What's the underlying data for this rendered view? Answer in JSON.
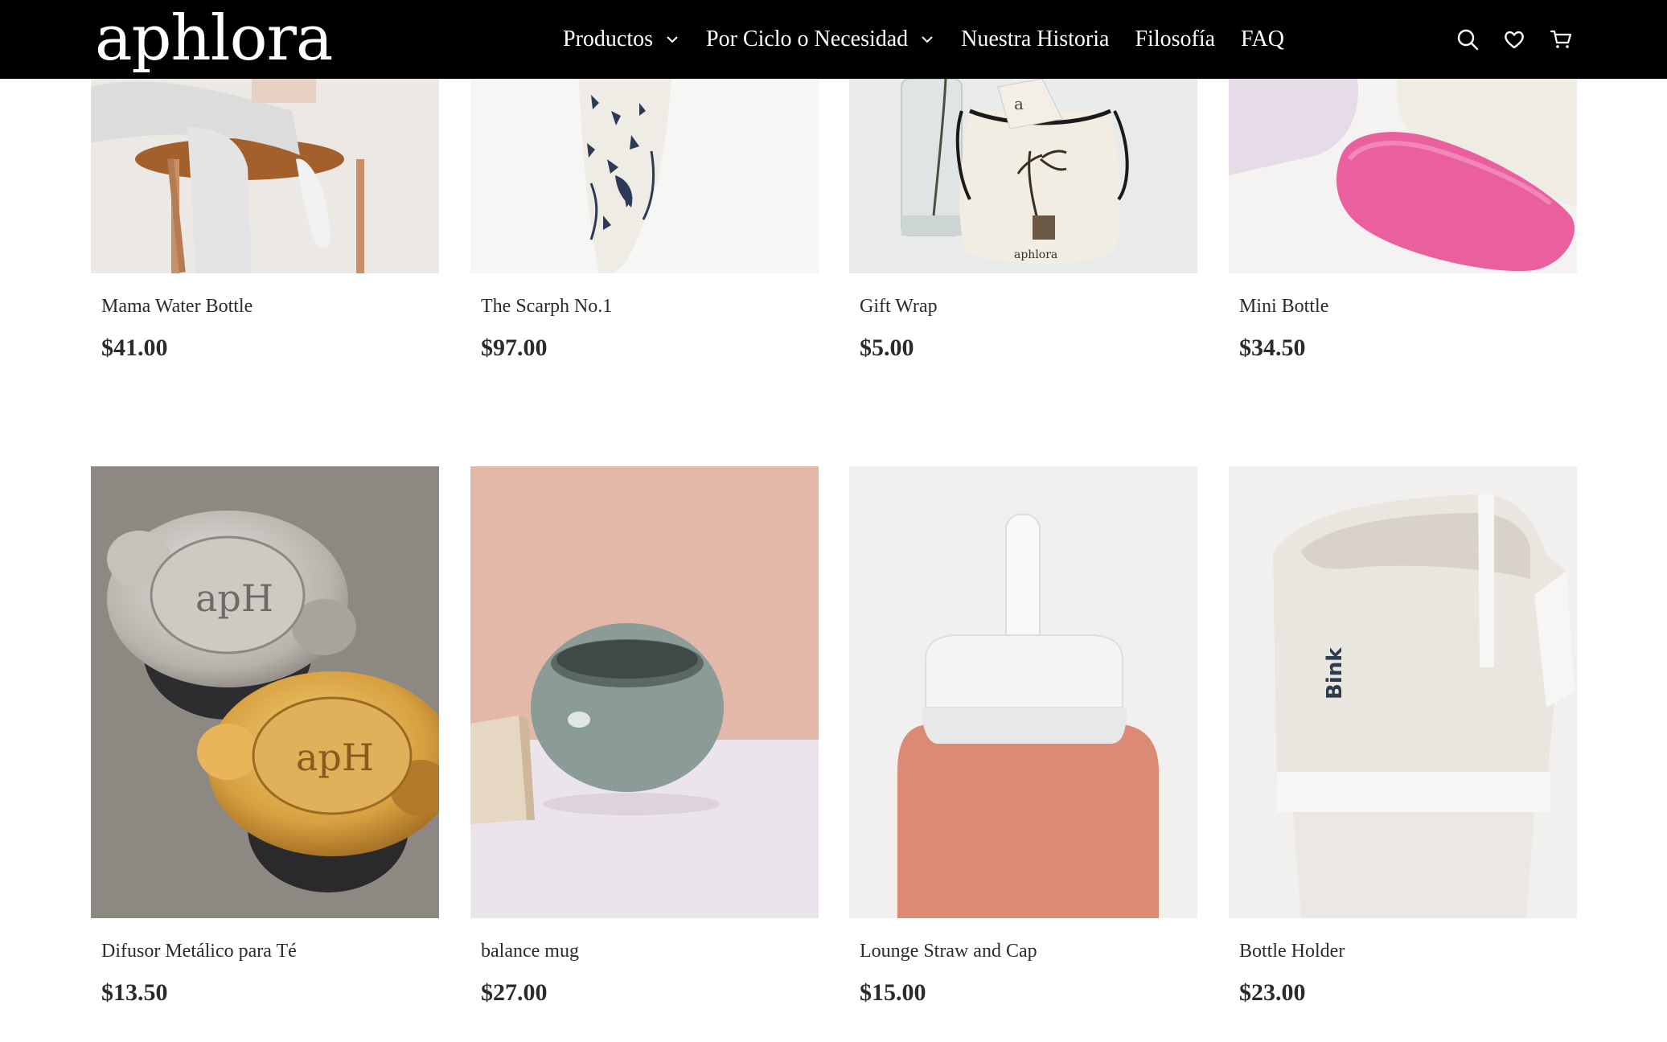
{
  "header": {
    "logo": "aphlora",
    "nav": [
      {
        "label": "Productos",
        "has_dropdown": true
      },
      {
        "label": "Por Ciclo o Necesidad",
        "has_dropdown": true
      },
      {
        "label": "Nuestra Historia",
        "has_dropdown": false
      },
      {
        "label": "Filosofía",
        "has_dropdown": false
      },
      {
        "label": "FAQ",
        "has_dropdown": false
      }
    ],
    "icons": [
      "search-icon",
      "heart-icon",
      "cart-icon"
    ]
  },
  "products": [
    {
      "name": "Mama Water Bottle",
      "price": "$41.00"
    },
    {
      "name": "The Scarph No.1",
      "price": "$97.00"
    },
    {
      "name": "Gift Wrap",
      "price": "$5.00",
      "image_text": "aphlora"
    },
    {
      "name": "Mini Bottle",
      "price": "$34.50"
    },
    {
      "name": "Difusor Metálico para Té",
      "price": "$13.50",
      "image_text": "apH"
    },
    {
      "name": "balance mug",
      "price": "$27.00"
    },
    {
      "name": "Lounge Straw and Cap",
      "price": "$15.00"
    },
    {
      "name": "Bottle Holder",
      "price": "$23.00",
      "image_text": "Bink"
    }
  ],
  "colors": {
    "header_bg": "#000000",
    "header_text": "#ffffff",
    "text": "#2b2b2b"
  }
}
